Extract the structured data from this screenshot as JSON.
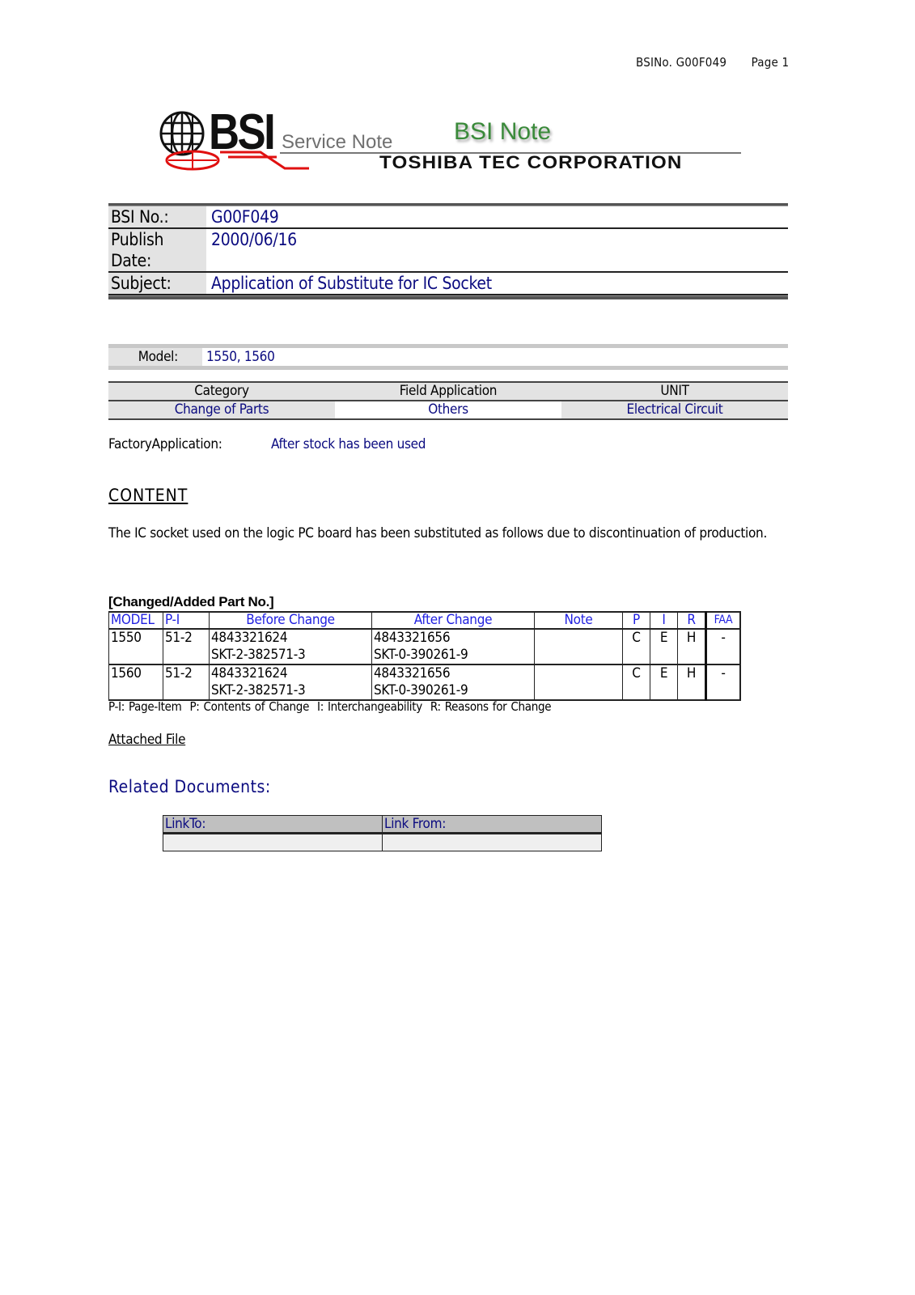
{
  "page_header": {
    "bsi_no": "BSINo. G00F049",
    "page": "Page 1"
  },
  "logo": {
    "bsi": "BSI",
    "service_note": "Service Note",
    "bsi_note": "BSI Note",
    "company": "TOSHIBA TEC CORPORATION"
  },
  "info": {
    "bsi_no_label": "BSI No.:",
    "bsi_no_value": "G00F049",
    "publish_label": "Publish Date:",
    "publish_value": "2000/06/16",
    "subject_label": "Subject:",
    "subject_value": "Application of Substitute for IC Socket"
  },
  "model": {
    "label": "Model:",
    "value": "1550, 1560"
  },
  "category": {
    "headers": [
      "Category",
      "Field Application",
      "UNIT"
    ],
    "values": [
      "Change of Parts",
      "Others",
      "Electrical Circuit"
    ]
  },
  "factory_application": {
    "label": "FactoryApplication:",
    "value": "After stock has been used"
  },
  "content": {
    "heading": "CONTENT",
    "body": "The IC socket used on the logic PC board has been substituted as follows due to discontinuation of production."
  },
  "parts": {
    "title": "[Changed/Added Part No.]",
    "headers": [
      "MODEL",
      "P-I",
      "Before Change",
      "After Change",
      "Note",
      "P",
      "I",
      "R",
      "FAA"
    ],
    "rows": [
      {
        "model": "1550",
        "pi": "51-2",
        "before_no": "4843321624",
        "before_desc": "SKT-2-382571-3",
        "after_no": "4843321656",
        "after_desc": "SKT-0-390261-9",
        "note": "",
        "p": "C",
        "i": "E",
        "r": "H",
        "faa": "-"
      },
      {
        "model": "1560",
        "pi": "51-2",
        "before_no": "4843321624",
        "before_desc": "SKT-2-382571-3",
        "after_no": "4843321656",
        "after_desc": "SKT-0-390261-9",
        "note": "",
        "p": "C",
        "i": "E",
        "r": "H",
        "faa": "-"
      }
    ],
    "legend": "P-I: Page-Item  P: Contents of Change  I: Interchangeability  R: Reasons for Change"
  },
  "attached_file": "Attached File",
  "related": {
    "heading": "Related Documents:",
    "link_to_label": "LinkTo:",
    "link_from_label": "Link From:",
    "link_to_value": "",
    "link_from_value": ""
  }
}
